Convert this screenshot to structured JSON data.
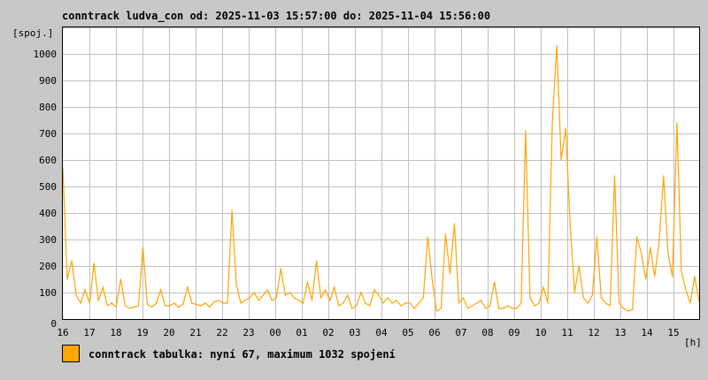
{
  "chart_data": {
    "type": "line",
    "title": "conntrack ludva_con od: 2025-11-03 15:57:00 do: 2025-11-04 15:56:00",
    "ylabel": "[spoj.]",
    "xlabel": "[h]",
    "ylim": [
      0,
      1100
    ],
    "yticks": [
      0,
      100,
      200,
      300,
      400,
      500,
      600,
      700,
      800,
      900,
      1000
    ],
    "xticks": [
      "16",
      "17",
      "18",
      "19",
      "20",
      "21",
      "22",
      "23",
      "00",
      "01",
      "02",
      "03",
      "04",
      "05",
      "06",
      "07",
      "08",
      "09",
      "10",
      "11",
      "12",
      "13",
      "14",
      "15"
    ],
    "grid": true,
    "series_color": "#ffa500",
    "sample_interval_minutes": 10,
    "series": [
      {
        "name": "conntrack tabulka",
        "values": [
          570,
          150,
          220,
          90,
          60,
          110,
          60,
          210,
          70,
          120,
          50,
          60,
          45,
          150,
          50,
          40,
          45,
          50,
          270,
          55,
          45,
          60,
          110,
          50,
          50,
          60,
          45,
          55,
          120,
          60,
          55,
          50,
          60,
          45,
          65,
          70,
          60,
          60,
          410,
          130,
          60,
          70,
          80,
          100,
          70,
          90,
          110,
          70,
          80,
          190,
          90,
          100,
          80,
          70,
          60,
          140,
          70,
          220,
          80,
          110,
          70,
          120,
          50,
          60,
          90,
          40,
          50,
          100,
          60,
          50,
          110,
          90,
          60,
          80,
          60,
          70,
          50,
          60,
          60,
          40,
          60,
          80,
          310,
          150,
          30,
          40,
          320,
          170,
          360,
          60,
          80,
          40,
          50,
          60,
          70,
          40,
          50,
          140,
          40,
          40,
          50,
          40,
          40,
          60,
          710,
          80,
          50,
          60,
          120,
          60,
          740,
          1032,
          600,
          720,
          360,
          100,
          200,
          80,
          60,
          90,
          310,
          80,
          60,
          50,
          540,
          60,
          40,
          30,
          35,
          310,
          250,
          150,
          270,
          160,
          290,
          540,
          250,
          160,
          740,
          180,
          110,
          60,
          160,
          67
        ]
      }
    ],
    "legend": {
      "text": "conntrack tabulka: nyní 67, maximum 1032 spojení",
      "placement": "bottom-left"
    }
  }
}
